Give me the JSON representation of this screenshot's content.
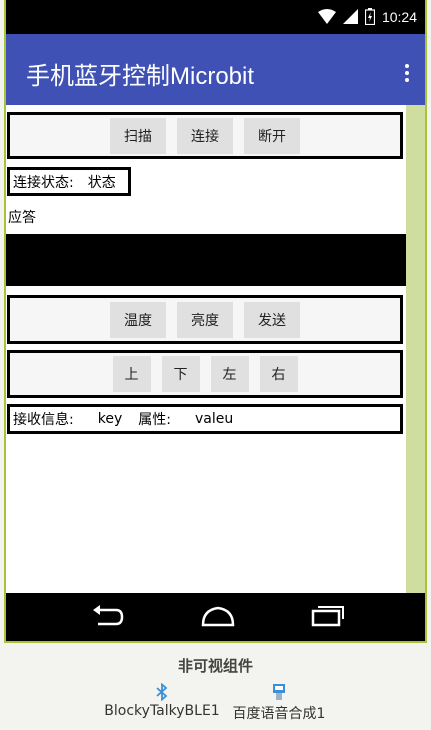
{
  "status_bar": {
    "time": "10:24"
  },
  "app_bar": {
    "title": "手机蓝牙控制Microbit"
  },
  "row1": {
    "scan": "扫描",
    "connect": "连接",
    "disconnect": "断开"
  },
  "connection": {
    "label": "连接状态:",
    "value": "状态"
  },
  "response_label": "应答",
  "row2": {
    "temperature": "温度",
    "brightness": "亮度",
    "send": "发送"
  },
  "row3": {
    "up": "上",
    "down": "下",
    "left": "左",
    "right": "右"
  },
  "receive": {
    "label": "接收信息:",
    "key": "key",
    "attr_label": "属性:",
    "value": "valeu"
  },
  "non_visible": {
    "heading": "非可视组件",
    "components": [
      "BlockyTalkyBLE1",
      "百度语音合成1"
    ]
  },
  "colors": {
    "app_bar": "#3f51b5",
    "device_frame": "#a8c23a",
    "scroll_track": "#cfdd9f"
  }
}
